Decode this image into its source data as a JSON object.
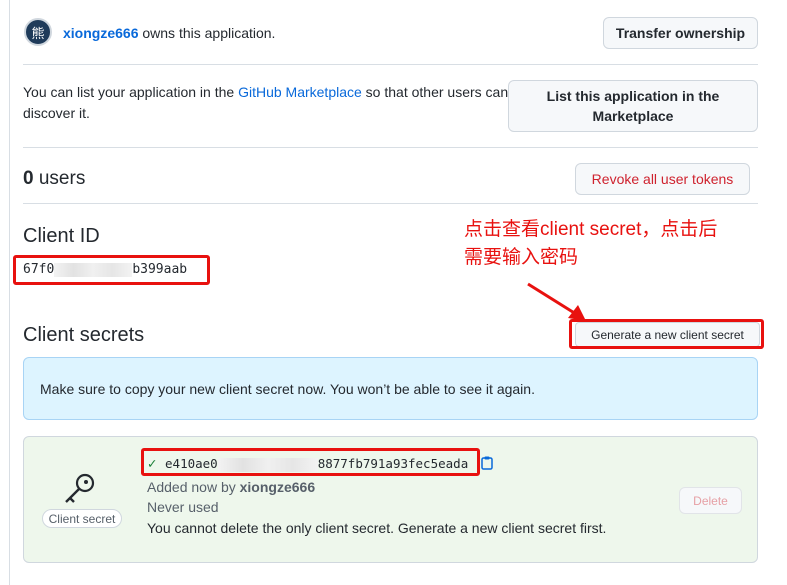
{
  "owner": {
    "avatar_glyph": "熊",
    "username": "xiongze666",
    "owns_text": " owns this application.",
    "transfer_label": "Transfer ownership"
  },
  "marketplace": {
    "text_before": "You can list your application in the ",
    "link": "GitHub Marketplace",
    "text_after_line1": " so that other users can",
    "text_line2": "discover it.",
    "button_label": "List this application in the Marketplace"
  },
  "users": {
    "count": "0",
    "label": " users",
    "revoke_label": "Revoke all user tokens"
  },
  "client_id": {
    "heading": "Client ID",
    "prefix": "67f0",
    "suffix": "b399aab"
  },
  "annotation": {
    "line1": "点击查看client secret，点击后",
    "line2": "需要输入密码"
  },
  "client_secrets": {
    "heading": "Client secrets",
    "generate_label": "Generate a new client secret",
    "flash": "Make sure to copy your new client secret now. You won’t be able to see it again.",
    "badge": "Client secret",
    "secret_prefix": "e410ae0",
    "secret_suffix": "8877fb791a93fec5eada",
    "added_text": "Added now by ",
    "added_by": "xiongze666",
    "never_used": "Never used",
    "cannot_delete": "You cannot delete the only client secret. Generate a new client secret first.",
    "delete_label": "Delete"
  },
  "colors": {
    "link": "#0969da",
    "danger": "#cf222e",
    "annotation_red": "#e8110f",
    "success_green": "#1a7f37",
    "flash_blue": "#ddf4ff",
    "secret_bg": "#eef7ec"
  }
}
